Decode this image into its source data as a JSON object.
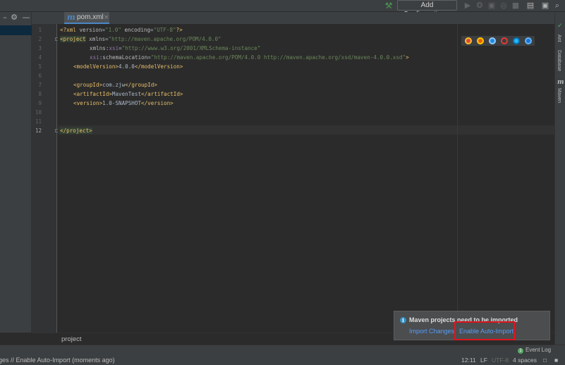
{
  "toolbar": {
    "add_configuration": "Add Configuration...",
    "icons": [
      "build-hammer-icon",
      "run-icon",
      "debug-icon",
      "coverage-icon",
      "profile-icon",
      "stop-icon",
      "project-structure-icon",
      "search-icon"
    ]
  },
  "tabs": [
    {
      "label": "pom.xml",
      "icon": "maven-m-icon",
      "close": "×"
    }
  ],
  "project_strip": {
    "gear": "⚙",
    "minimize": "—"
  },
  "editor": {
    "line_numbers": [
      "1",
      "2",
      "3",
      "4",
      "5",
      "6",
      "7",
      "8",
      "9",
      "10",
      "11",
      "12"
    ],
    "current_line": "12",
    "lines": {
      "l1": {
        "open": "<?xml ",
        "a1": "version",
        "eq1": "=",
        "v1": "\"1.0\"",
        "sp": " ",
        "a2": "encoding",
        "eq2": "=",
        "v2": "\"UTF-8\"",
        "close": "?>"
      },
      "l2": {
        "tag": "<project",
        "sp": " ",
        "attr": "xmlns",
        "eq": "=",
        "val": "\"http://maven.apache.org/POM/4.0.0\""
      },
      "l3": {
        "attr": "xmlns",
        "colon": ":",
        "ns": "xsi",
        "eq": "=",
        "val": "\"http://www.w3.org/2001/XMLSchema-instance\""
      },
      "l4": {
        "ns": "xsi",
        "colon": ":",
        "attr": "schemaLocation",
        "eq": "=",
        "val": "\"http://maven.apache.org/POM/4.0.0 http://maven.apache.org/xsd/maven-4.0.0.xsd\"",
        "close": ">"
      },
      "l5": {
        "open": "<modelVersion>",
        "text": "4.0.0",
        "close": "</modelVersion>"
      },
      "l7": {
        "open": "<groupId>",
        "text": "com.zjw",
        "close": "</groupId>"
      },
      "l8": {
        "open": "<artifactId>",
        "text": "MavenTest",
        "close": "</artifactId>"
      },
      "l9": {
        "open": "<version>",
        "text": "1.0-SNAPSHOT",
        "close": "</version>"
      },
      "l12": {
        "tag": "</project>"
      }
    }
  },
  "browser_icons": [
    "chrome-icon",
    "firefox-icon",
    "safari-icon",
    "opera-icon",
    "ie-icon",
    "edge-icon"
  ],
  "right_strip": {
    "ant": "Ant",
    "database": "Database",
    "maven": "Maven"
  },
  "breadcrumb": {
    "item": "project"
  },
  "notification": {
    "title": "Maven projects need to be imported",
    "import_changes": "Import Changes",
    "enable_auto_import": "Enable Auto-Import"
  },
  "statusbar": {
    "message": "anges // Enable Auto-Import (moments ago)",
    "position": "12:11",
    "line_separator": "LF",
    "encoding": "UTF-8",
    "indent": "4 spaces",
    "event_log": "Event Log"
  },
  "colors": {
    "tag": "#e8bf6a",
    "value": "#6a8759",
    "namespace": "#9876aa",
    "link": "#589df6",
    "highlight_box": "#e0141c"
  }
}
